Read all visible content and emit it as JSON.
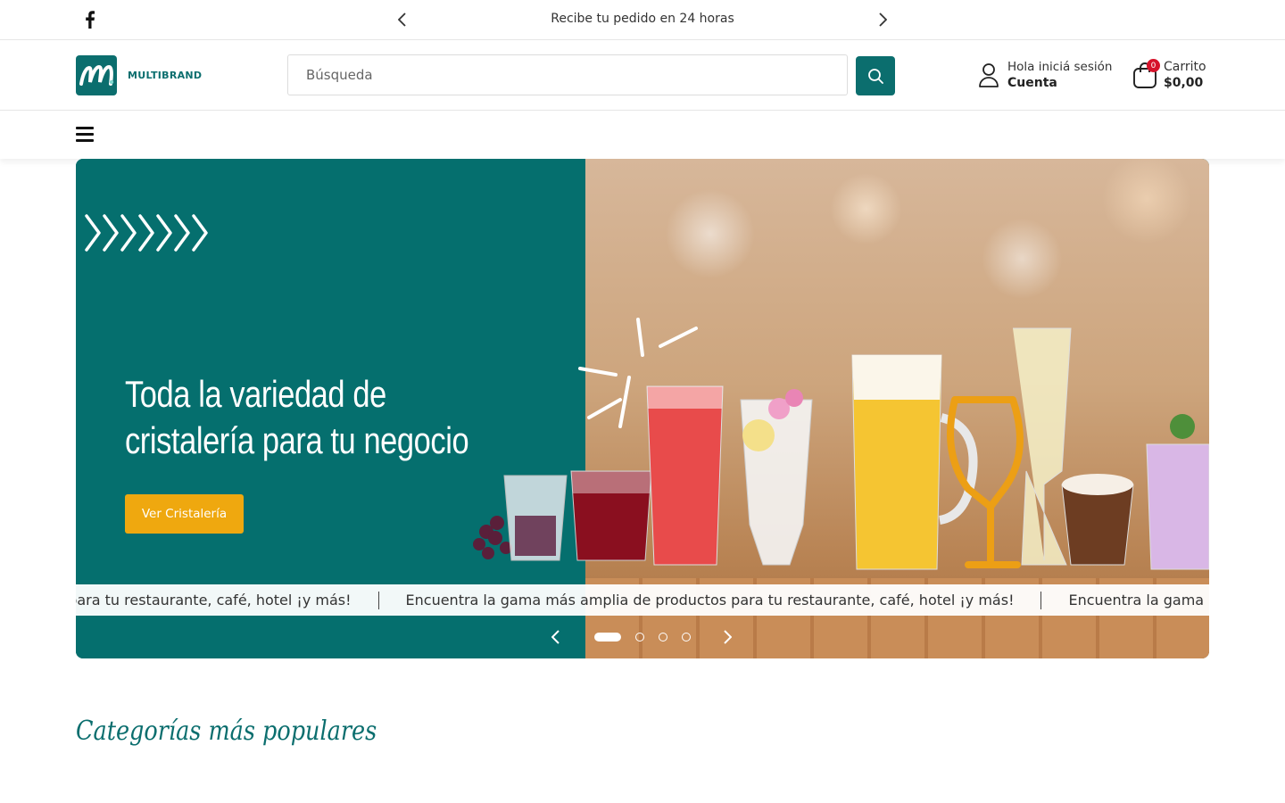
{
  "announcement": {
    "text": "Recibe tu pedido en 24 horas"
  },
  "brand": {
    "name": "MULTIBRAND",
    "accent_color": "#0b6e6e"
  },
  "search": {
    "placeholder": "Búsqueda",
    "value": ""
  },
  "account": {
    "greeting": "Hola iniciá sesión",
    "label": "Cuenta"
  },
  "cart": {
    "label": "Carrito",
    "total": "$0,00",
    "count": "0"
  },
  "hero": {
    "title": "Toda la variedad de cristalería para tu negocio",
    "cta_label": "Ver Cristalería",
    "cta_color": "#efa80f",
    "marquee_fragment": "os para tu restaurante, café, hotel ¡y más!",
    "marquee_text": "Encuentra la gama más amplia de productos para tu restaurante, café, hotel ¡y más!",
    "marquee_tail": "Encuentra la gama más amplia de productos para tu restaurante, café, hotel ¡y más!",
    "slides": 4,
    "active_slide": 1
  },
  "categories": {
    "title": "Categorías más populares"
  }
}
